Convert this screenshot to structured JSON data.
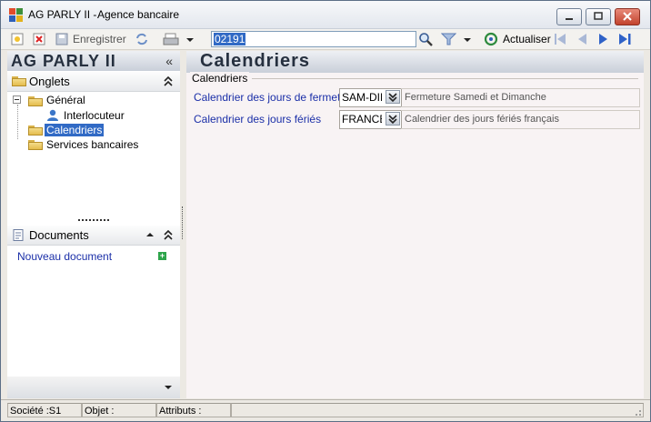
{
  "window": {
    "title": "AG PARLY II -",
    "subtitle": "Agence bancaire"
  },
  "toolbar": {
    "save_label": "Enregistrer",
    "search_value": "02191",
    "refresh_label": "Actualiser"
  },
  "left": {
    "brand": "AG PARLY II",
    "brand_toggle": "«",
    "onglets_header": "Onglets",
    "tree": {
      "general": "Général",
      "interlocuteur": "Interlocuteur",
      "calendriers": "Calendriers",
      "services": "Services bancaires"
    },
    "documents_header": "Documents",
    "new_document": "Nouveau document"
  },
  "main": {
    "title": "Calendriers",
    "group_label": "Calendriers",
    "fields": [
      {
        "label": "Calendrier des jours de fermeture",
        "value": "SAM-DIM",
        "description": "Fermeture Samedi et  Dimanche"
      },
      {
        "label": "Calendrier des jours fériés",
        "value": "FRANCE",
        "description": "Calendrier des jours fériés français"
      }
    ]
  },
  "status": {
    "societe": "Société :S1",
    "objet": "Objet :",
    "attributs": "Attributs :"
  },
  "colors": {
    "selection": "#316ac5",
    "link": "#1b2fa8",
    "header_text": "#26303f"
  }
}
